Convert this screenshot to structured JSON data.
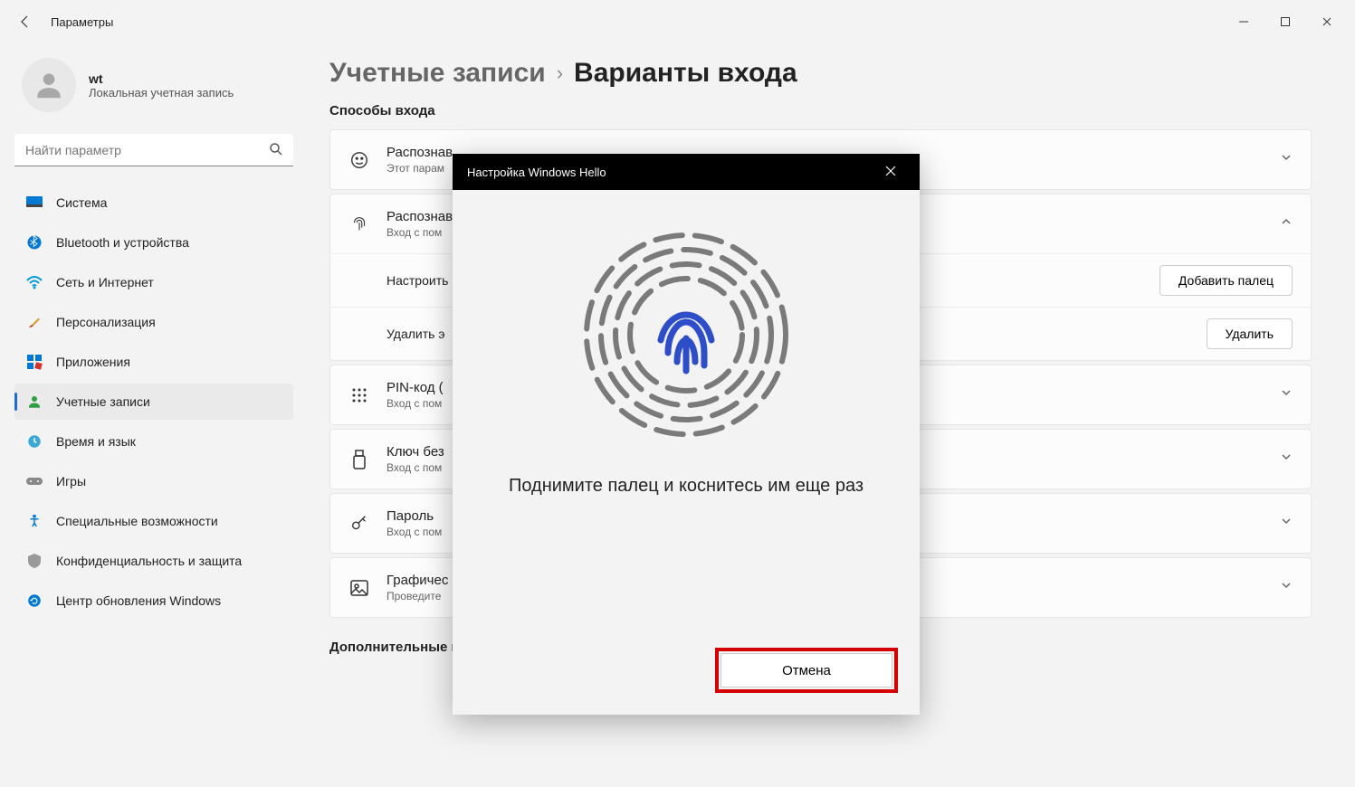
{
  "window": {
    "title": "Параметры"
  },
  "user": {
    "name": "wt",
    "subtitle": "Локальная учетная запись"
  },
  "search": {
    "placeholder": "Найти параметр"
  },
  "nav": {
    "items": [
      {
        "label": "Система"
      },
      {
        "label": "Bluetooth и устройства"
      },
      {
        "label": "Сеть и Интернет"
      },
      {
        "label": "Персонализация"
      },
      {
        "label": "Приложения"
      },
      {
        "label": "Учетные записи"
      },
      {
        "label": "Время и язык"
      },
      {
        "label": "Игры"
      },
      {
        "label": "Специальные возможности"
      },
      {
        "label": "Конфиденциальность и защита"
      },
      {
        "label": "Центр обновления Windows"
      }
    ]
  },
  "breadcrumb": {
    "parent": "Учетные записи",
    "current": "Варианты входа"
  },
  "sections": {
    "methods": "Способы входа",
    "additional": "Дополнительные параметры"
  },
  "cards": {
    "face": {
      "title": "Распознав",
      "sub": "Этот парам"
    },
    "finger": {
      "title": "Распознав",
      "sub": "Вход с пом",
      "setup": "Настроить",
      "remove_label": "Удалить э",
      "add_btn": "Добавить палец",
      "remove_btn": "Удалить"
    },
    "pin": {
      "title": "PIN-код (",
      "sub": "Вход с пом"
    },
    "key": {
      "title": "Ключ без",
      "sub": "Вход с пом"
    },
    "password": {
      "title": "Пароль",
      "sub": "Вход с пом"
    },
    "picture": {
      "title": "Графичес",
      "sub": "Проведите"
    }
  },
  "modal": {
    "title": "Настройка Windows Hello",
    "instruction": "Поднимите палец и коснитесь им еще раз",
    "cancel": "Отмена"
  }
}
